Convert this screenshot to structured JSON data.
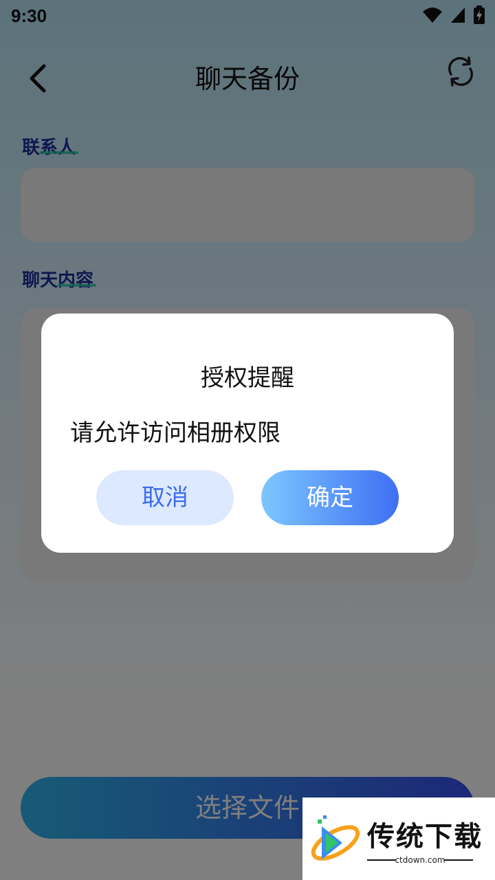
{
  "status_bar": {
    "time": "9:30",
    "icons": [
      "wifi-icon",
      "signal-icon",
      "battery-charging-icon"
    ]
  },
  "header": {
    "title": "聊天备份",
    "back_icon": "chevron-left-icon",
    "refresh_icon": "refresh-icon"
  },
  "form": {
    "contact_label": "联系人",
    "contact_value": "",
    "content_label": "聊天内容",
    "content_value": ""
  },
  "primary_button": {
    "label": "选择文件"
  },
  "dialog": {
    "title": "授权提醒",
    "message": "请允许访问相册权限",
    "cancel_label": "取消",
    "confirm_label": "确定"
  },
  "watermark": {
    "text": "传统下载",
    "url": "ctdown.com"
  },
  "colors": {
    "section_label": "#1a2f9e",
    "underline": "#27c8a4",
    "cancel_bg": "#dde9ff",
    "cancel_text": "#3d6cf0",
    "confirm_start": "#7cc7ff",
    "confirm_end": "#3f6ff4",
    "select_start": "#2fb6ec",
    "select_end": "#3a4ff0"
  }
}
